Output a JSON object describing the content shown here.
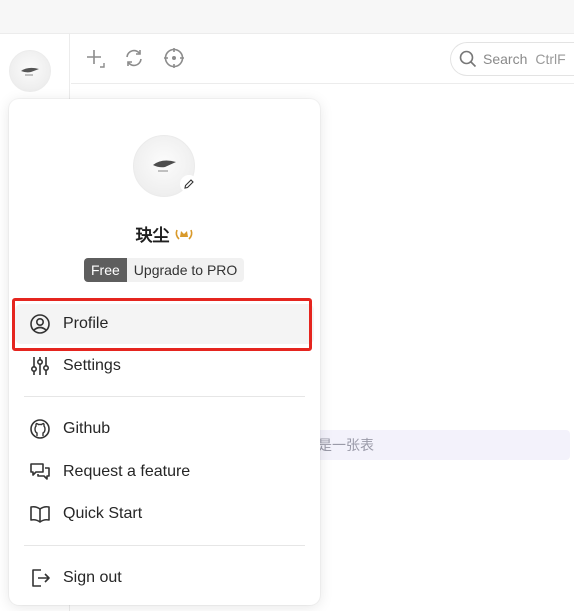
{
  "toolbar": {
    "icons": [
      "add-icon",
      "refresh-icon",
      "target-icon"
    ],
    "search": {
      "label": "Search",
      "shortcut": "CtrlF"
    }
  },
  "background": {
    "row_text": "是一张表"
  },
  "menu": {
    "username": "玦尘",
    "badge_icon": "crown-laurel-icon",
    "plan": {
      "current": "Free",
      "upgrade": "Upgrade to PRO"
    },
    "items": [
      {
        "label": "Profile",
        "icon": "user-circle-icon"
      },
      {
        "label": "Settings",
        "icon": "sliders-icon"
      },
      {
        "label": "Github",
        "icon": "github-icon"
      },
      {
        "label": "Request a feature",
        "icon": "chat-bubbles-icon"
      },
      {
        "label": "Quick Start",
        "icon": "book-open-icon"
      },
      {
        "label": "Sign out",
        "icon": "sign-out-icon"
      }
    ]
  },
  "colors": {
    "highlight": "#e5251f",
    "badge": "#d99a2b",
    "plan_free_bg": "#5e5e5e"
  }
}
